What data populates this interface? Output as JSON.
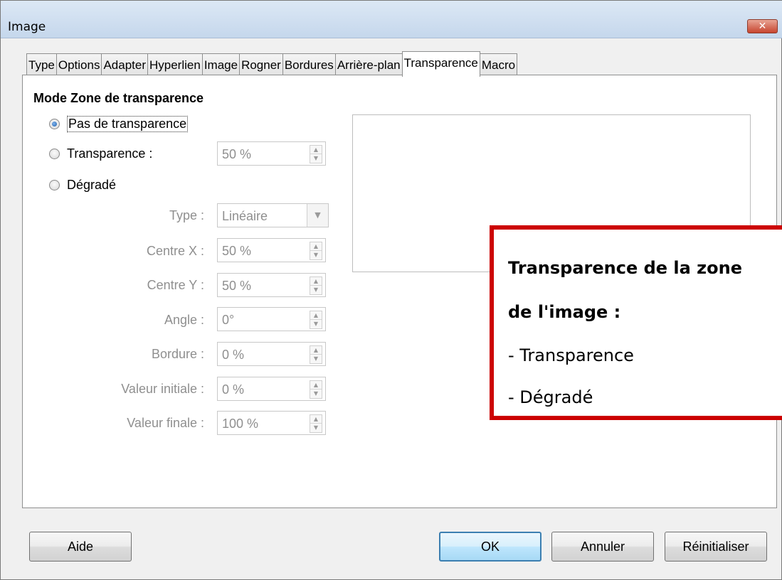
{
  "window": {
    "title": "Image",
    "close_glyph": "✕"
  },
  "tabs": [
    {
      "label": "Type"
    },
    {
      "label": "Options"
    },
    {
      "label": "Adapter"
    },
    {
      "label": "Hyperlien"
    },
    {
      "label": "Image"
    },
    {
      "label": "Rogner"
    },
    {
      "label": "Bordures"
    },
    {
      "label": "Arrière-plan"
    },
    {
      "label": "Transparence",
      "active": true
    },
    {
      "label": "Macro"
    }
  ],
  "section": {
    "title": "Mode Zone de transparence"
  },
  "radios": {
    "none": {
      "label": "Pas de transparence",
      "checked": true
    },
    "transparency": {
      "label": "Transparence :",
      "checked": false,
      "value": "50 %"
    },
    "gradient": {
      "label": "Dégradé",
      "checked": false
    }
  },
  "gradient_fields": {
    "type": {
      "label": "Type :",
      "value": "Linéaire"
    },
    "center_x": {
      "label": "Centre X :",
      "value": "50 %"
    },
    "center_y": {
      "label": "Centre Y :",
      "value": "50 %"
    },
    "angle": {
      "label": "Angle :",
      "value": "0°"
    },
    "border": {
      "label": "Bordure :",
      "value": "0 %"
    },
    "initial": {
      "label": "Valeur initiale :",
      "value": "0 %"
    },
    "final": {
      "label": "Valeur finale :",
      "value": "100 %"
    }
  },
  "callout": {
    "line1": "Transparence de la zone",
    "line2": "de l'image :",
    "line3": "- Transparence",
    "line4": "- Dégradé",
    "border_color": "#cc0000"
  },
  "buttons": {
    "help": "Aide",
    "ok": "OK",
    "cancel": "Annuler",
    "reset": "Réinitialiser"
  },
  "icons": {
    "spin_up": "▲",
    "spin_down": "▼",
    "dropdown": "▼"
  }
}
